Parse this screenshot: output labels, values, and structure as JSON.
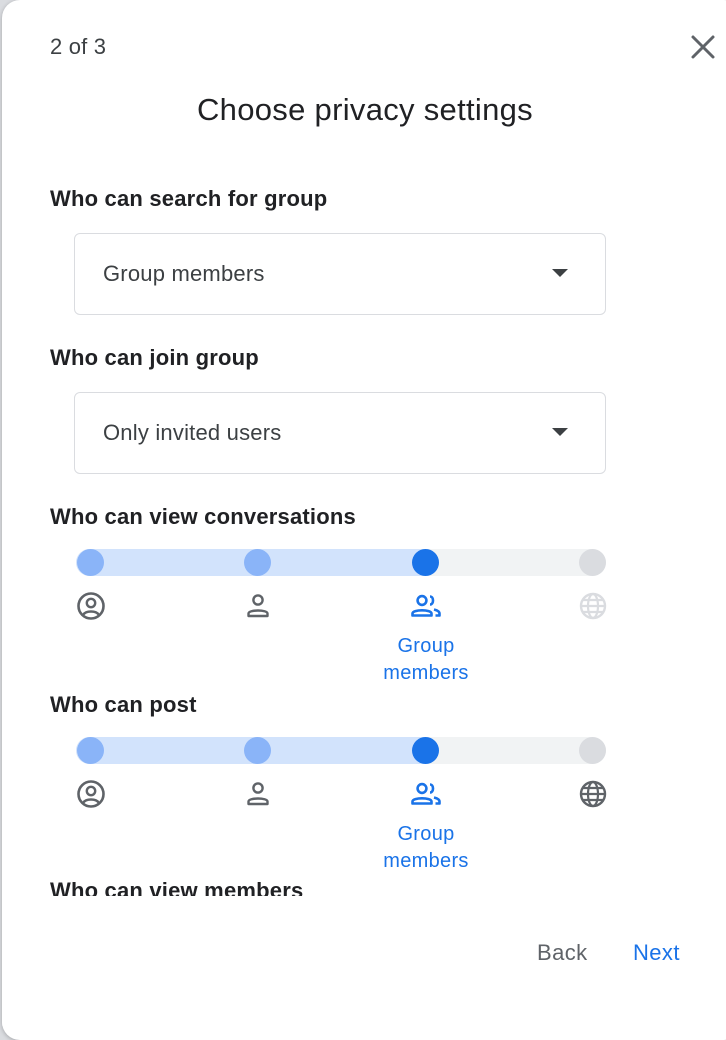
{
  "dialog": {
    "step": "2 of 3",
    "title": "Choose privacy settings"
  },
  "sections": {
    "search": {
      "label": "Who can search for group",
      "value": "Group members"
    },
    "join": {
      "label": "Who can join group",
      "value": "Only invited users"
    },
    "view_conversations": {
      "label": "Who can view conversations",
      "caption_line1": "Group",
      "caption_line2": "members",
      "selected_index": 2
    },
    "post": {
      "label": "Who can post",
      "caption_line1": "Group",
      "caption_line2": "members",
      "selected_index": 2
    },
    "view_members": {
      "label": "Who can view members"
    }
  },
  "slider_icons": [
    "account-circle-icon",
    "person-icon",
    "group-icon",
    "globe-icon"
  ],
  "footer": {
    "back_label": "Back",
    "next_label": "Next"
  },
  "colors": {
    "accent": "#1a73e8",
    "accent_light": "#8ab4f8",
    "track_fill": "#d2e3fc",
    "track_empty": "#f1f3f4",
    "stop_inactive": "#dadce0",
    "text": "#202124",
    "muted": "#5f6368"
  }
}
